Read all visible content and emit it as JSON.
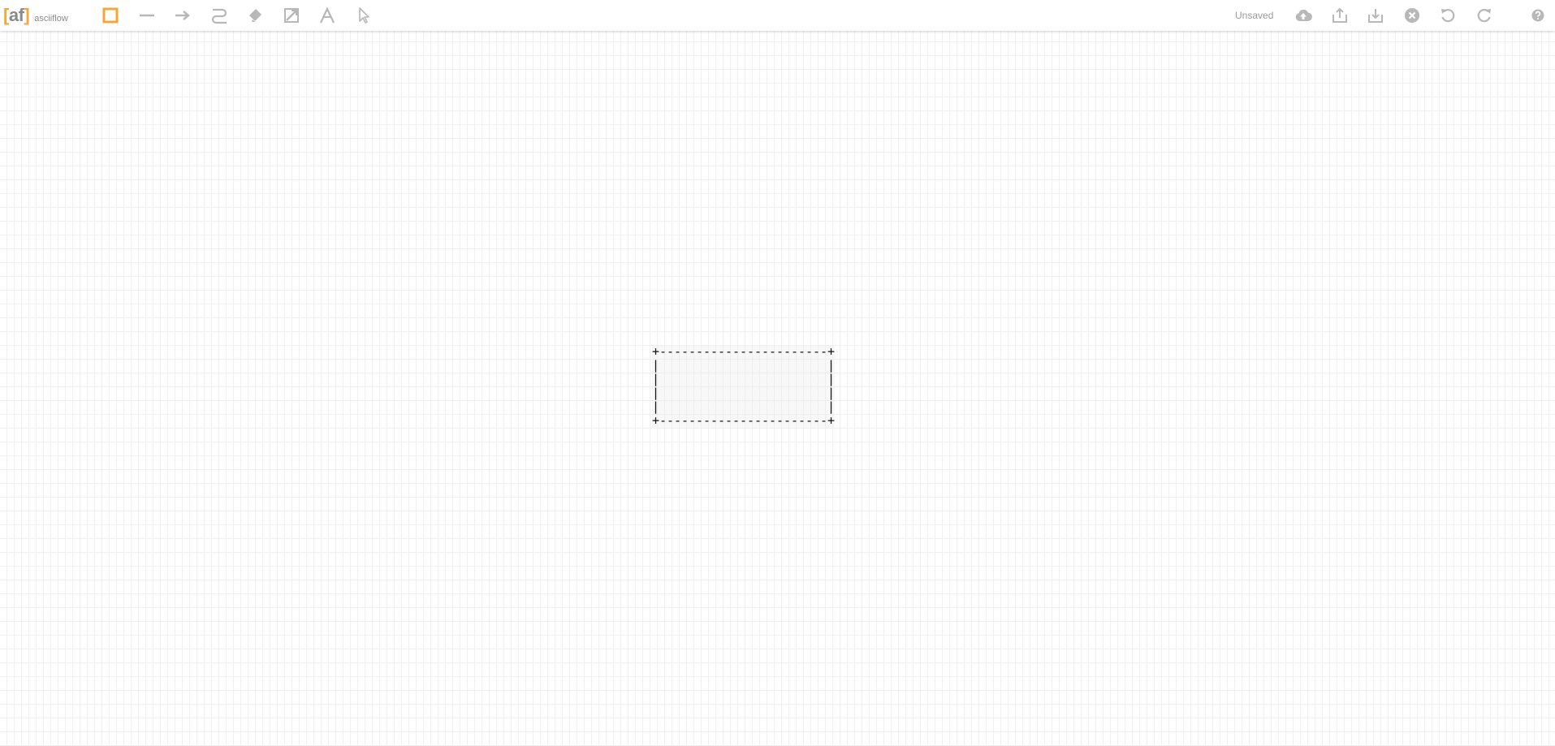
{
  "app": {
    "logo_left_bracket": "[",
    "logo_letters": "af",
    "logo_right_bracket": "]",
    "name": "asciiflow"
  },
  "toolbar": {
    "tools": [
      {
        "id": "box",
        "icon": "box-icon",
        "active": true
      },
      {
        "id": "line",
        "icon": "line-icon",
        "active": false
      },
      {
        "id": "arrow",
        "icon": "arrow-icon",
        "active": false
      },
      {
        "id": "freeform",
        "icon": "freeform-icon",
        "active": false
      },
      {
        "id": "erase",
        "icon": "eraser-icon",
        "active": false
      },
      {
        "id": "move",
        "icon": "resize-icon",
        "active": false
      },
      {
        "id": "text",
        "icon": "text-icon",
        "active": false
      },
      {
        "id": "select",
        "icon": "cursor-icon",
        "active": false
      }
    ],
    "status": "Unsaved",
    "actions": [
      {
        "id": "drive",
        "icon": "cloud-upload-icon"
      },
      {
        "id": "export",
        "icon": "export-icon"
      },
      {
        "id": "import",
        "icon": "import-icon"
      },
      {
        "id": "clear",
        "icon": "clear-icon"
      },
      {
        "id": "undo",
        "icon": "undo-icon"
      },
      {
        "id": "redo",
        "icon": "redo-icon"
      },
      {
        "id": "help",
        "icon": "help-icon"
      }
    ]
  },
  "colors": {
    "accent": "#f4a63a",
    "icon": "#b8b8b8",
    "text_muted": "#9a9a9a",
    "grid": "#f0f0f0"
  },
  "canvas": {
    "ascii_drawing": "+-----------------------+\n|                       |\n|                       |\n|                       |\n|                       |\n+-----------------------+"
  }
}
